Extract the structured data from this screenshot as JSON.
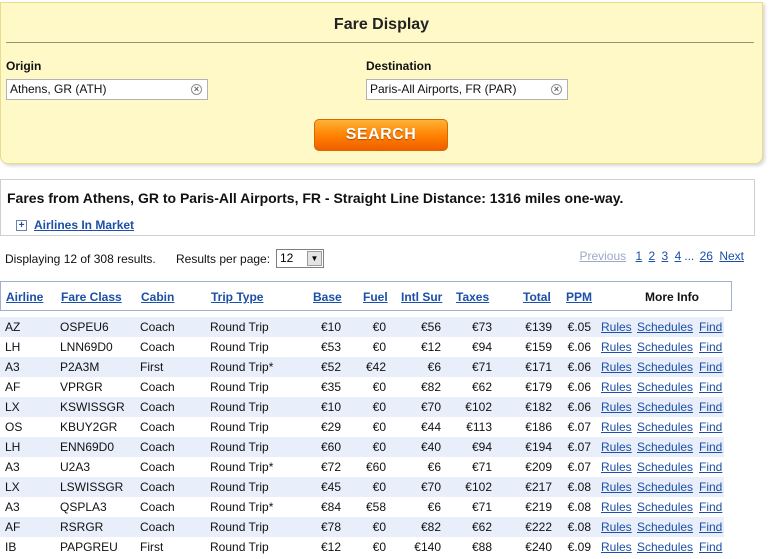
{
  "search": {
    "title": "Fare Display",
    "origin_label": "Origin",
    "origin_value": "Athens, GR (ATH)",
    "destination_label": "Destination",
    "destination_value": "Paris-All Airports, FR (PAR)",
    "clear_symbol": "×",
    "button_label": "SEARCH"
  },
  "summary": {
    "text": "Fares from Athens, GR to Paris-All Airports, FR - Straight Line Distance: 1316 miles one-way.",
    "airlines_toggle": "+",
    "airlines_link": "Airlines In Market"
  },
  "results": {
    "info": "Displaying 12 of 308 results.",
    "per_page_label": "Results per page:",
    "per_page_value": "12",
    "pager": {
      "previous": "Previous",
      "pages": [
        "1",
        "2",
        "3",
        "4"
      ],
      "dots": "...",
      "last": "26",
      "next": "Next"
    }
  },
  "table": {
    "headers": {
      "airline": "Airline",
      "fare_class": "Fare Class",
      "cabin": "Cabin",
      "trip_type": "Trip Type",
      "base": "Base",
      "fuel": "Fuel",
      "intl_sur": "Intl Sur",
      "taxes": "Taxes",
      "total": "Total",
      "ppm": "PPM",
      "more_info": "More Info"
    },
    "link_labels": {
      "rules": "Rules",
      "schedules": "Schedules",
      "find": "Find"
    },
    "rows": [
      {
        "airline": "AZ",
        "fare_class": "OSPEU6",
        "cabin": "Coach",
        "trip_type": "Round Trip",
        "base": "€10",
        "fuel": "€0",
        "intl_sur": "€56",
        "taxes": "€73",
        "total": "€139",
        "ppm": "€.05"
      },
      {
        "airline": "LH",
        "fare_class": "LNN69D0",
        "cabin": "Coach",
        "trip_type": "Round Trip",
        "base": "€53",
        "fuel": "€0",
        "intl_sur": "€12",
        "taxes": "€94",
        "total": "€159",
        "ppm": "€.06"
      },
      {
        "airline": "A3",
        "fare_class": "P2A3M",
        "cabin": "First",
        "trip_type": "Round Trip*",
        "base": "€52",
        "fuel": "€42",
        "intl_sur": "€6",
        "taxes": "€71",
        "total": "€171",
        "ppm": "€.06"
      },
      {
        "airline": "AF",
        "fare_class": "VPRGR",
        "cabin": "Coach",
        "trip_type": "Round Trip",
        "base": "€35",
        "fuel": "€0",
        "intl_sur": "€82",
        "taxes": "€62",
        "total": "€179",
        "ppm": "€.06"
      },
      {
        "airline": "LX",
        "fare_class": "KSWISSGR",
        "cabin": "Coach",
        "trip_type": "Round Trip",
        "base": "€10",
        "fuel": "€0",
        "intl_sur": "€70",
        "taxes": "€102",
        "total": "€182",
        "ppm": "€.06"
      },
      {
        "airline": "OS",
        "fare_class": "KBUY2GR",
        "cabin": "Coach",
        "trip_type": "Round Trip",
        "base": "€29",
        "fuel": "€0",
        "intl_sur": "€44",
        "taxes": "€113",
        "total": "€186",
        "ppm": "€.07"
      },
      {
        "airline": "LH",
        "fare_class": "ENN69D0",
        "cabin": "Coach",
        "trip_type": "Round Trip",
        "base": "€60",
        "fuel": "€0",
        "intl_sur": "€40",
        "taxes": "€94",
        "total": "€194",
        "ppm": "€.07"
      },
      {
        "airline": "A3",
        "fare_class": "U2A3",
        "cabin": "Coach",
        "trip_type": "Round Trip*",
        "base": "€72",
        "fuel": "€60",
        "intl_sur": "€6",
        "taxes": "€71",
        "total": "€209",
        "ppm": "€.07"
      },
      {
        "airline": "LX",
        "fare_class": "LSWISSGR",
        "cabin": "Coach",
        "trip_type": "Round Trip",
        "base": "€45",
        "fuel": "€0",
        "intl_sur": "€70",
        "taxes": "€102",
        "total": "€217",
        "ppm": "€.08"
      },
      {
        "airline": "A3",
        "fare_class": "QSPLA3",
        "cabin": "Coach",
        "trip_type": "Round Trip*",
        "base": "€84",
        "fuel": "€58",
        "intl_sur": "€6",
        "taxes": "€71",
        "total": "€219",
        "ppm": "€.08"
      },
      {
        "airline": "AF",
        "fare_class": "RSRGR",
        "cabin": "Coach",
        "trip_type": "Round Trip",
        "base": "€78",
        "fuel": "€0",
        "intl_sur": "€82",
        "taxes": "€62",
        "total": "€222",
        "ppm": "€.08"
      },
      {
        "airline": "IB",
        "fare_class": "PAPGREU",
        "cabin": "First",
        "trip_type": "Round Trip",
        "base": "€12",
        "fuel": "€0",
        "intl_sur": "€140",
        "taxes": "€88",
        "total": "€240",
        "ppm": "€.09"
      }
    ]
  },
  "colors": {
    "panel_bg": "#fff9c8",
    "link": "#1b4fa8",
    "row_alt": "#e8eefa",
    "button_orange": "#ff7f00"
  }
}
